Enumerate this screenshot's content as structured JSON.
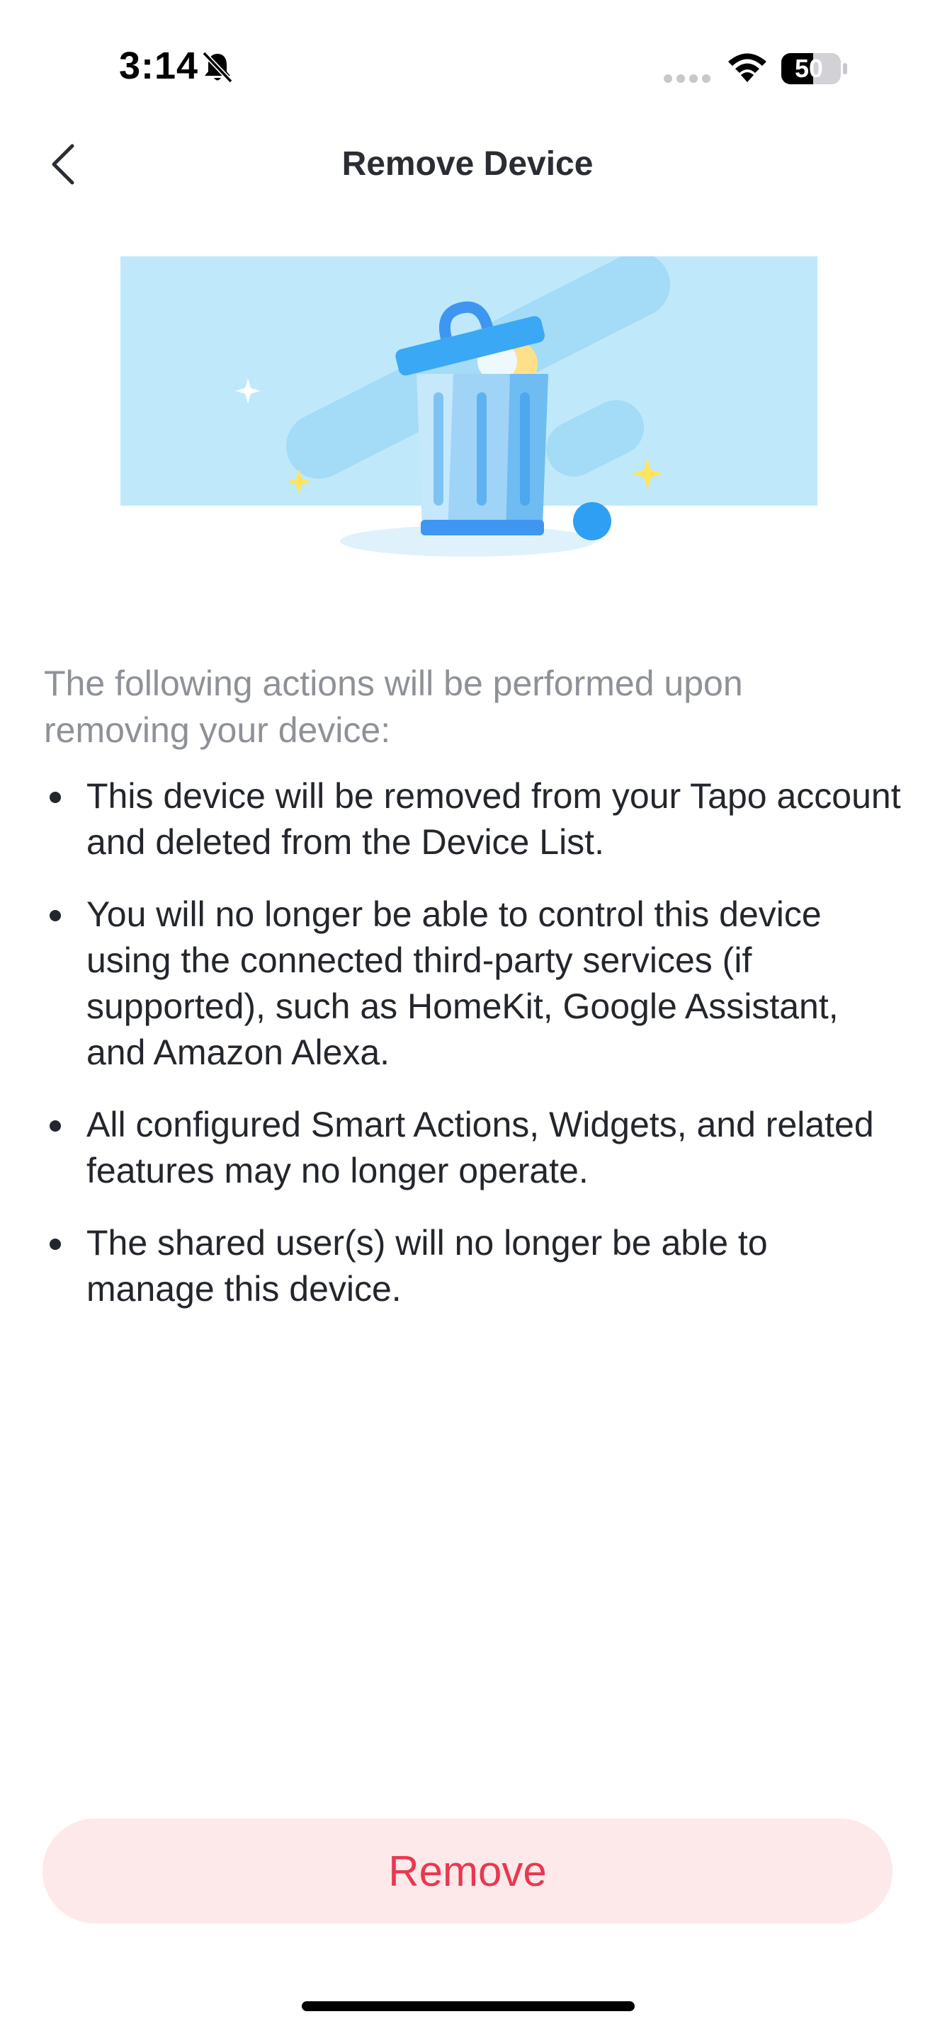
{
  "status_bar": {
    "time": "3:14",
    "battery": "50",
    "icons": [
      "bell-slash-icon",
      "cellular-signal-icon",
      "wifi-icon",
      "battery-icon"
    ]
  },
  "nav": {
    "back_icon": "chevron-left-icon",
    "title": "Remove Device"
  },
  "illustration": {
    "icon": "trash-can-illustration",
    "colors": {
      "background": "#bfe9fb",
      "accent_blue": "#3aa8f5",
      "sparkle_yellow": "#ffe45c"
    }
  },
  "content": {
    "intro": "The following actions will be performed upon removing your device:",
    "actions": [
      "This device will be removed from your Tapo account and deleted from the Device List.",
      "You will no longer be able to control this device using the connected third-party services (if supported), such as HomeKit, Google Assistant, and Amazon Alexa.",
      "All configured Smart Actions, Widgets, and related features may no longer operate.",
      "The shared user(s) will no longer be able to manage this device."
    ]
  },
  "footer": {
    "remove_label": "Remove",
    "colors": {
      "button_bg": "#fde8ea",
      "button_text": "#e8384f"
    }
  }
}
